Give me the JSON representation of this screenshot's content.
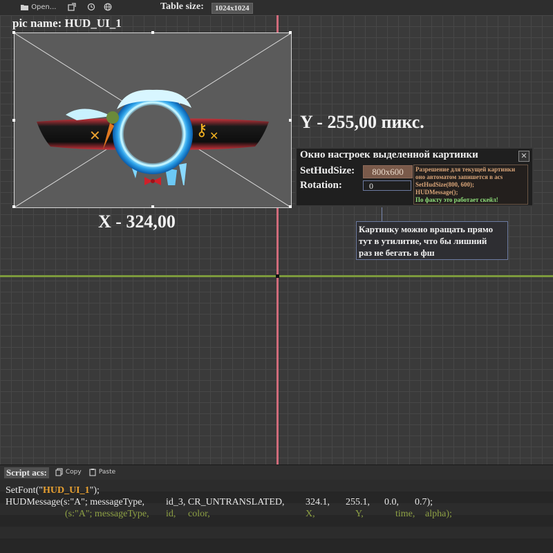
{
  "toolbar": {
    "open_label": "Open...",
    "table_size_label": "Table size:",
    "table_size_value": "1024x1024",
    "icons": [
      "folder-icon",
      "export-icon",
      "history-icon",
      "globe-icon"
    ]
  },
  "canvas": {
    "pic_name": "pic name: HUD_UI_1",
    "y_readout": "Y - 255,00 пикс.",
    "x_readout": "X - 324,00",
    "colors": {
      "axis_vertical": "#d06b7b",
      "axis_horizontal": "#7c9a3c"
    }
  },
  "settings": {
    "title": "Окно настроек выделенной картинки",
    "close_label": "✕",
    "hudsize_label": "SetHudSize:",
    "hudsize_value": "800x600",
    "rotation_label": "Rotation:",
    "rotation_value": "0",
    "note": {
      "line1": "Разрешение для текущей картинки",
      "line2": "оно автоматом запишется в acs",
      "line3": "SetHudSize(800, 600);",
      "line4": "HUDMessage();",
      "line5": "По факту это работает скейл!"
    }
  },
  "tip": {
    "line1": "Картинку можно вращать прямо",
    "line2": "тут в утилитие, что бы лишний",
    "line3": "раз не бегать в фш"
  },
  "script": {
    "label": "Script acs:",
    "copy_label": "Copy",
    "paste_label": "Paste",
    "line1_prefix": "SetFont(\"",
    "line1_font": "HUD_UI_1",
    "line1_suffix": "\");",
    "line2": {
      "c1": "HUDMessage(s:\"A\"; messageType,",
      "c2": "id_3, CR_UNTRANSLATED,",
      "c3": "324.1,",
      "c4": "255.1,",
      "c5": "0.0,",
      "c6": "0.7);"
    },
    "line3": {
      "c1": "(s:\"A\"; messageType,",
      "c2": "id,",
      "c3": "color,",
      "c4": "X,",
      "c5": "Y,",
      "c6": "time,",
      "c7": "alpha);"
    }
  }
}
